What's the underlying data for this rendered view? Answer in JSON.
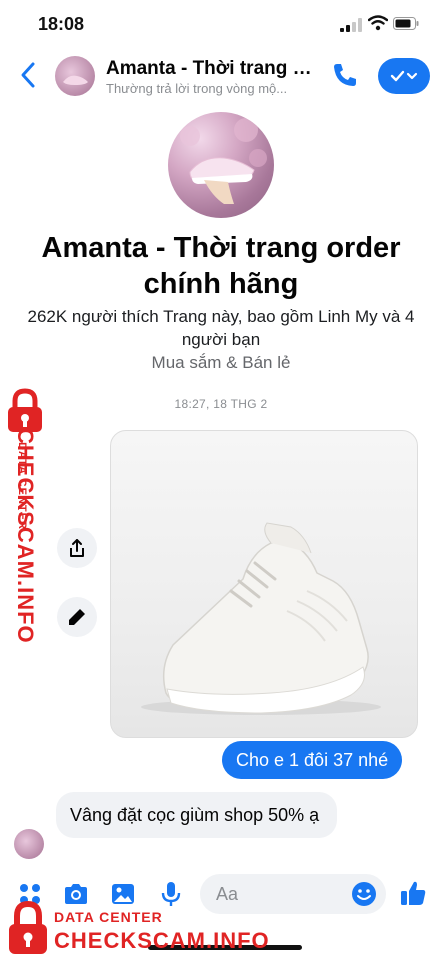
{
  "status_bar": {
    "time": "18:08"
  },
  "header": {
    "name": "Amanta - Thời trang o...",
    "subtitle": "Thường trả lời trong vòng mộ..."
  },
  "profile": {
    "name": "Amanta - Thời trang order chính hãng",
    "likes": "262K người thích Trang này, bao gồm Linh My và 4 người bạn",
    "category": "Mua sắm & Bán lẻ"
  },
  "conversation": {
    "timestamp": "18:27, 18 THG 2",
    "outgoing_message": "Cho e 1 đôi 37 nhé",
    "incoming_message": "Vâng đặt cọc giùm shop 50% ạ"
  },
  "composer": {
    "placeholder": "Aa"
  },
  "watermark": {
    "label_small": "DATA CENTER",
    "label_big": "CHECKSCAM.INFO"
  },
  "colors": {
    "accent": "#1877f2",
    "watermark": "#e02424"
  }
}
